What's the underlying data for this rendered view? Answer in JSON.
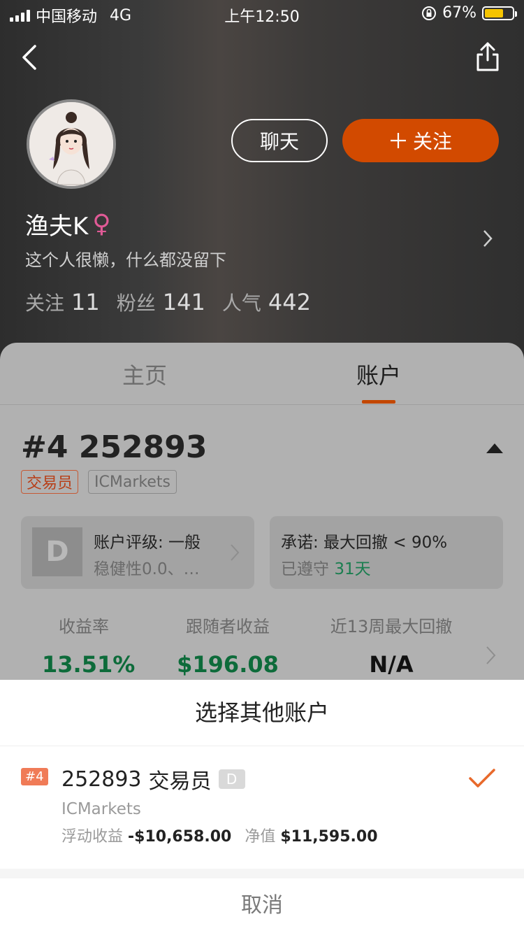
{
  "status_bar": {
    "carrier": "中国移动",
    "network": "4G",
    "time": "上午12:50",
    "battery": "67%"
  },
  "profile": {
    "chat_label": "聊天",
    "follow_label": "关注",
    "name": "渔夫K",
    "gender_symbol": "♀",
    "bio": "这个人很懒，什么都没留下",
    "stats": {
      "following_label": "关注",
      "following": "11",
      "fans_label": "粉丝",
      "fans": "141",
      "popularity_label": "人气",
      "popularity": "442"
    }
  },
  "tabs": {
    "home": "主页",
    "account": "账户"
  },
  "account": {
    "title": "#4 252893",
    "tag_role": "交易员",
    "tag_broker": "ICMarkets",
    "grade_letter": "D",
    "grade_title": "账户评级: 一般",
    "grade_detail": "稳健性0.0、…",
    "promise_title": "承诺: 最大回撤 < 90%",
    "promise_prefix": "已遵守",
    "promise_days": "31天",
    "metrics": [
      {
        "label": "收益率",
        "value": "13.51%"
      },
      {
        "label": "跟随者收益",
        "value": "$196.08"
      },
      {
        "label": "近13周最大回撤",
        "value": "N/A"
      }
    ]
  },
  "sheet": {
    "title": "选择其他账户",
    "item": {
      "rank": "#4",
      "number": "252893",
      "role": "交易员",
      "grade": "D",
      "broker": "ICMarkets",
      "float_label": "浮动收益",
      "float_value": "-$10,658.00",
      "equity_label": "净值",
      "equity_value": "$11,595.00"
    },
    "cancel": "取消"
  }
}
